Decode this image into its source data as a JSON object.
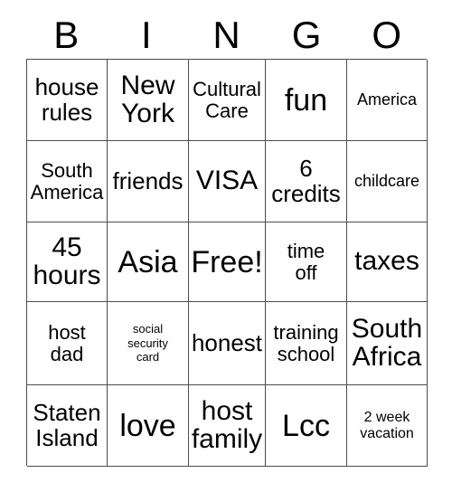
{
  "card": {
    "header_letters": [
      "B",
      "I",
      "N",
      "G",
      "O"
    ],
    "columns": 5,
    "rows": 5,
    "grid_line_color": "#4d4d4d",
    "text_color": "#000000",
    "background_color": "#ffffff",
    "free_space": "Free!",
    "cells": [
      [
        {
          "text": "house\nrules",
          "size": "l"
        },
        {
          "text": "New\nYork",
          "size": "xl"
        },
        {
          "text": "Cultural\nCare",
          "size": "m"
        },
        {
          "text": "fun",
          "size": "xxl"
        },
        {
          "text": "America",
          "size": "s"
        }
      ],
      [
        {
          "text": "South\nAmerica",
          "size": "m"
        },
        {
          "text": "friends",
          "size": "l"
        },
        {
          "text": "VISA",
          "size": "xl"
        },
        {
          "text": "6\ncredits",
          "size": "l"
        },
        {
          "text": "childcare",
          "size": "s"
        }
      ],
      [
        {
          "text": "45\nhours",
          "size": "xl"
        },
        {
          "text": "Asia",
          "size": "xxl"
        },
        {
          "text": "Free!",
          "size": "xxl"
        },
        {
          "text": "time\noff",
          "size": "m"
        },
        {
          "text": "taxes",
          "size": "xl"
        }
      ],
      [
        {
          "text": "host\ndad",
          "size": "m"
        },
        {
          "text": "social\nsecurity\ncard",
          "size": "xxs"
        },
        {
          "text": "honest",
          "size": "l"
        },
        {
          "text": "training\nschool",
          "size": "m"
        },
        {
          "text": "South\nAfrica",
          "size": "xl"
        }
      ],
      [
        {
          "text": "Staten\nIsland",
          "size": "l"
        },
        {
          "text": "love",
          "size": "xxl"
        },
        {
          "text": "host\nfamily",
          "size": "xl"
        },
        {
          "text": "Lcc",
          "size": "xxl"
        },
        {
          "text": "2 week\nvacation",
          "size": "xs"
        }
      ]
    ]
  }
}
